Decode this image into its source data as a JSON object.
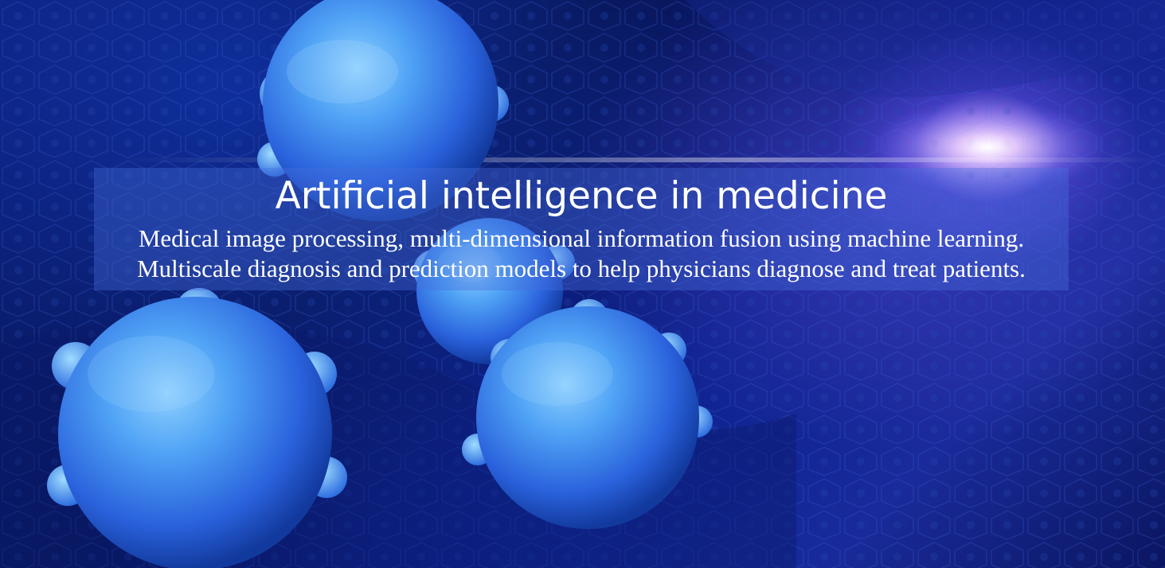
{
  "hero": {
    "title": "Artificial intelligence in medicine",
    "lines": [
      "Medical image processing, multi-dimensional information fusion using machine learning.",
      "Multiscale diagnosis and prediction models to help physicians diagnose and treat patients."
    ],
    "background": "blue-cells-illustration"
  },
  "colors": {
    "background": "#0b1f7a",
    "cell": "#3f8cf0",
    "panel": "#466edc",
    "text": "#ffffff"
  }
}
